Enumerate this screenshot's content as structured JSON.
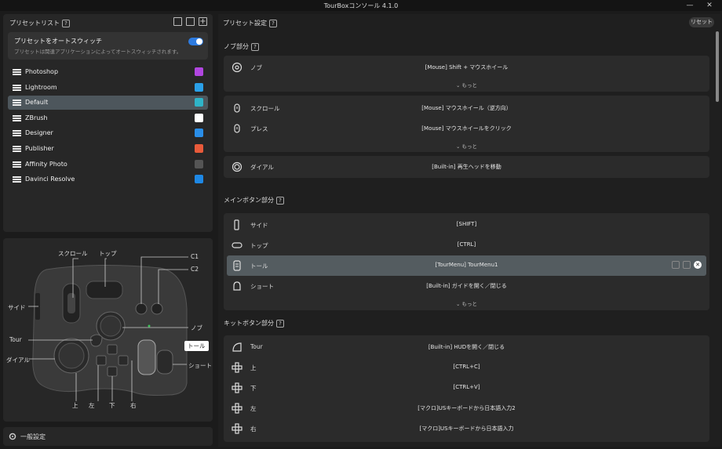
{
  "window": {
    "title": "TourBoxコンソール 4.1.0"
  },
  "left": {
    "header": "プリセットリスト",
    "auto_switch": {
      "title": "プリセットをオートスウィッチ",
      "subtitle": "プリセットは関連アプリケーションによってオートスウィッチされます。",
      "enabled": true
    },
    "presets": [
      {
        "name": "Photoshop",
        "color": "#b146e0"
      },
      {
        "name": "Lightroom",
        "color": "#2aa0e8"
      },
      {
        "name": "Default",
        "color": "#2fb4c8",
        "selected": true
      },
      {
        "name": "ZBrush",
        "color": "#ffffff"
      },
      {
        "name": "Designer",
        "color": "#2a8ee8"
      },
      {
        "name": "Publisher",
        "color": "#e85a3a"
      },
      {
        "name": "Affinity Photo",
        "color": "#555555"
      },
      {
        "name": "Davinci Resolve",
        "color": "#1e88e5"
      }
    ],
    "general_settings": "一般設定"
  },
  "device_labels": {
    "scroll": "スクロール",
    "top": "トップ",
    "c1": "C1",
    "c2": "C2",
    "side": "サイド",
    "knob": "ノブ",
    "tour": "Tour",
    "tall": "トール",
    "dial": "ダイアル",
    "short": "ショート",
    "up": "上",
    "left": "左",
    "down": "下",
    "right": "右"
  },
  "right": {
    "header": "プリセット設定",
    "reset": "リセット",
    "more": "もっと",
    "sections": {
      "knob": "ノブ部分",
      "main": "メインボタン部分",
      "kit": "キットボタン部分"
    },
    "knob_rows": [
      {
        "name": "ノブ",
        "value": "[Mouse] Shift + マウスホイール"
      }
    ],
    "scroll_rows": [
      {
        "name": "スクロール",
        "value": "[Mouse] マウスホイール（逆方向）"
      },
      {
        "name": "プレス",
        "value": "[Mouse] マウスホイールをクリック"
      }
    ],
    "dial_rows": [
      {
        "name": "ダイアル",
        "value": "[Built-in] 再生ヘッドを移動"
      }
    ],
    "main_rows": [
      {
        "name": "サイド",
        "value": "[SHIFT]"
      },
      {
        "name": "トップ",
        "value": "[CTRL]"
      },
      {
        "name": "トール",
        "value": "[TourMenu] TourMenu1",
        "selected": true
      },
      {
        "name": "ショート",
        "value": "[Built-in] ガイドを開く／閉じる"
      }
    ],
    "kit_rows": [
      {
        "name": "Tour",
        "value": "[Built-in] HUDを開く／閉じる"
      },
      {
        "name": "上",
        "value": "[CTRL+C]"
      },
      {
        "name": "下",
        "value": "[CTRL+V]"
      },
      {
        "name": "左",
        "value": "[マクロ]USキーボードから日本語入力2"
      },
      {
        "name": "右",
        "value": "[マクロ]USキーボードから日本語入力"
      }
    ]
  }
}
